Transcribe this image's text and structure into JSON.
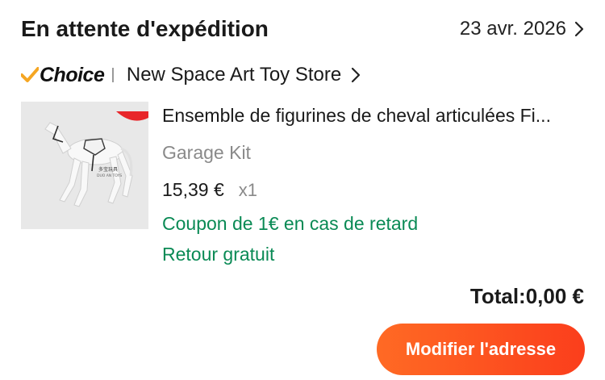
{
  "order": {
    "status": "En attente d'expédition",
    "date": "23 avr. 2026"
  },
  "store": {
    "badge": "Choice",
    "name": "New Space Art Toy Store"
  },
  "product": {
    "title": "Ensemble de figurines de cheval articulées Fi...",
    "variant": "Garage Kit",
    "price": "15,39 €",
    "quantity": "x1",
    "image_watermark": "多宝玩具 DUO AN TOYS"
  },
  "badges": {
    "coupon": "Coupon de 1€ en cas de retard",
    "return": "Retour gratuit"
  },
  "summary": {
    "total": "Total:0,00 €"
  },
  "actions": {
    "modify_address": "Modifier l'adresse"
  },
  "colors": {
    "accent_orange": "#ff5a1f",
    "choice_check": "#f5a623",
    "green_text": "#0a8a55",
    "muted_text": "#8a8a8a"
  },
  "icons": [
    "chevron-right-icon",
    "choice-check-icon",
    "horse-figure-image"
  ]
}
